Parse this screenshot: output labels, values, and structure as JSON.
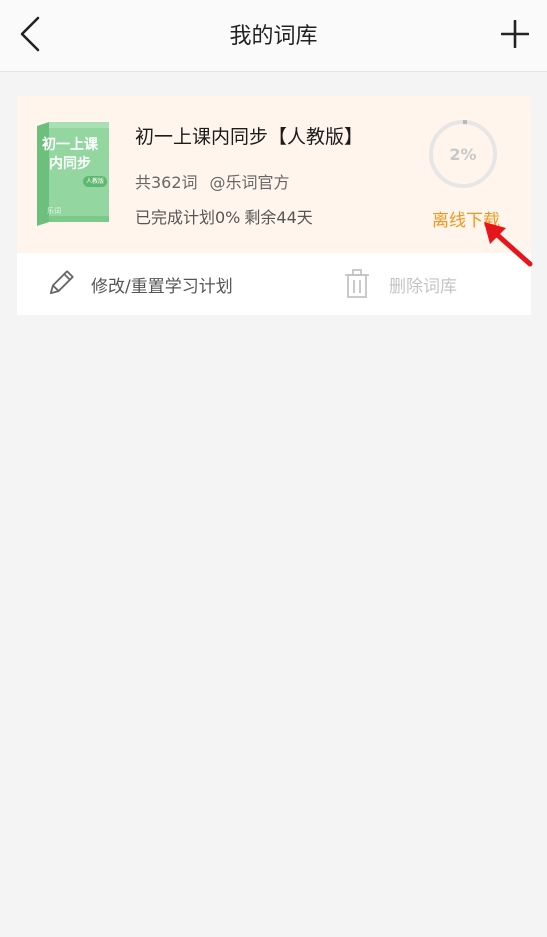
{
  "header": {
    "title": "我的词库",
    "back_icon": "chevron-left-icon",
    "add_icon": "plus-icon"
  },
  "book": {
    "cover_title": "初一上课内同步",
    "cover_badge": "人教版",
    "cover_foot": "乐词",
    "name": "初一上课内同步【人教版】",
    "word_count": "共362词",
    "author": "@乐词官方",
    "completed": "已完成计划0%",
    "remaining": "剩余44天",
    "download_progress_percent": 2,
    "download_progress_label": "2%",
    "download_label": "离线下载"
  },
  "actions": {
    "edit_label": "修改/重置学习计划",
    "delete_label": "删除词库"
  },
  "colors": {
    "accent": "#f3961e",
    "card_highlight": "#fff5ec",
    "arrow": "#e8141c",
    "cover_green": "#8fd39b"
  }
}
